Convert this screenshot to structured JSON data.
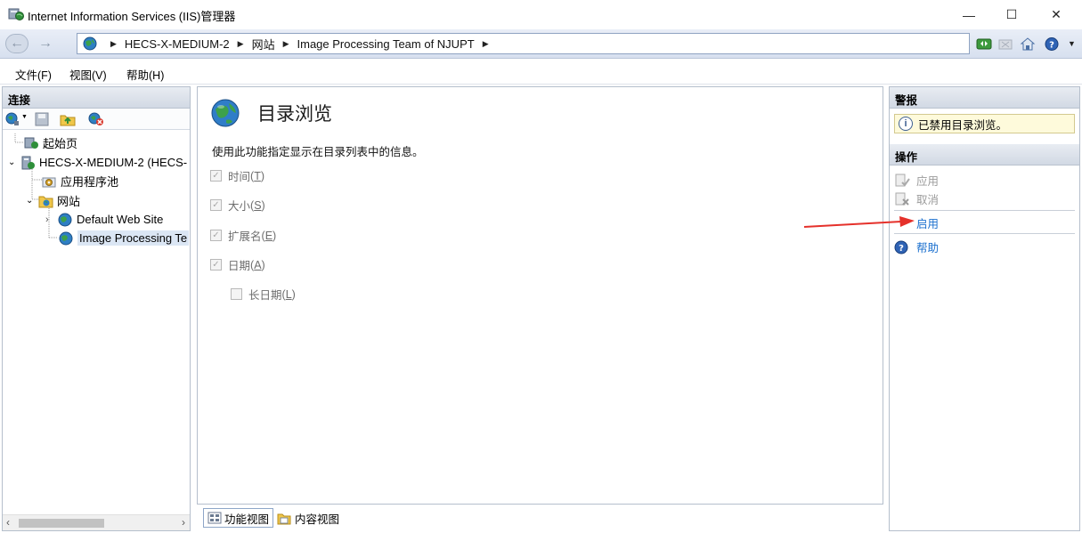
{
  "window": {
    "title": "Internet Information Services (IIS)管理器",
    "minimize": "—",
    "maximize": "☐",
    "close": "✕"
  },
  "address": {
    "crumbs": [
      "HECS-X-MEDIUM-2",
      "网站",
      "Image Processing Team of NJUPT"
    ]
  },
  "menu": {
    "items": [
      "文件(F)",
      "视图(V)",
      "帮助(H)"
    ]
  },
  "connections": {
    "header": "连接",
    "tree": [
      {
        "label": "起始页"
      },
      {
        "label": "HECS-X-MEDIUM-2 (HECS-"
      },
      {
        "label": "应用程序池"
      },
      {
        "label": "网站"
      },
      {
        "label": "Default Web Site"
      },
      {
        "label": "Image Processing Te"
      }
    ]
  },
  "feature": {
    "title": "目录浏览",
    "description": "使用此功能指定显示在目录列表中的信息。",
    "options": [
      {
        "label": "时间",
        "key": "T",
        "checked": true
      },
      {
        "label": "大小",
        "key": "S",
        "checked": true
      },
      {
        "label": "扩展名",
        "key": "E",
        "checked": true
      },
      {
        "label": "日期",
        "key": "A",
        "checked": true
      },
      {
        "label": "长日期",
        "key": "L",
        "checked": false
      }
    ]
  },
  "bottom_tabs": {
    "features_view": "功能视图",
    "content_view": "内容视图"
  },
  "alerts": {
    "header": "警报",
    "message": "已禁用目录浏览。"
  },
  "actions": {
    "header": "操作",
    "apply": "应用",
    "cancel": "取消",
    "enable": "启用",
    "help": "帮助"
  },
  "colors": {
    "link": "#1a6fce",
    "arrow": "#e5312b",
    "alert_bg": "#fefadb"
  }
}
